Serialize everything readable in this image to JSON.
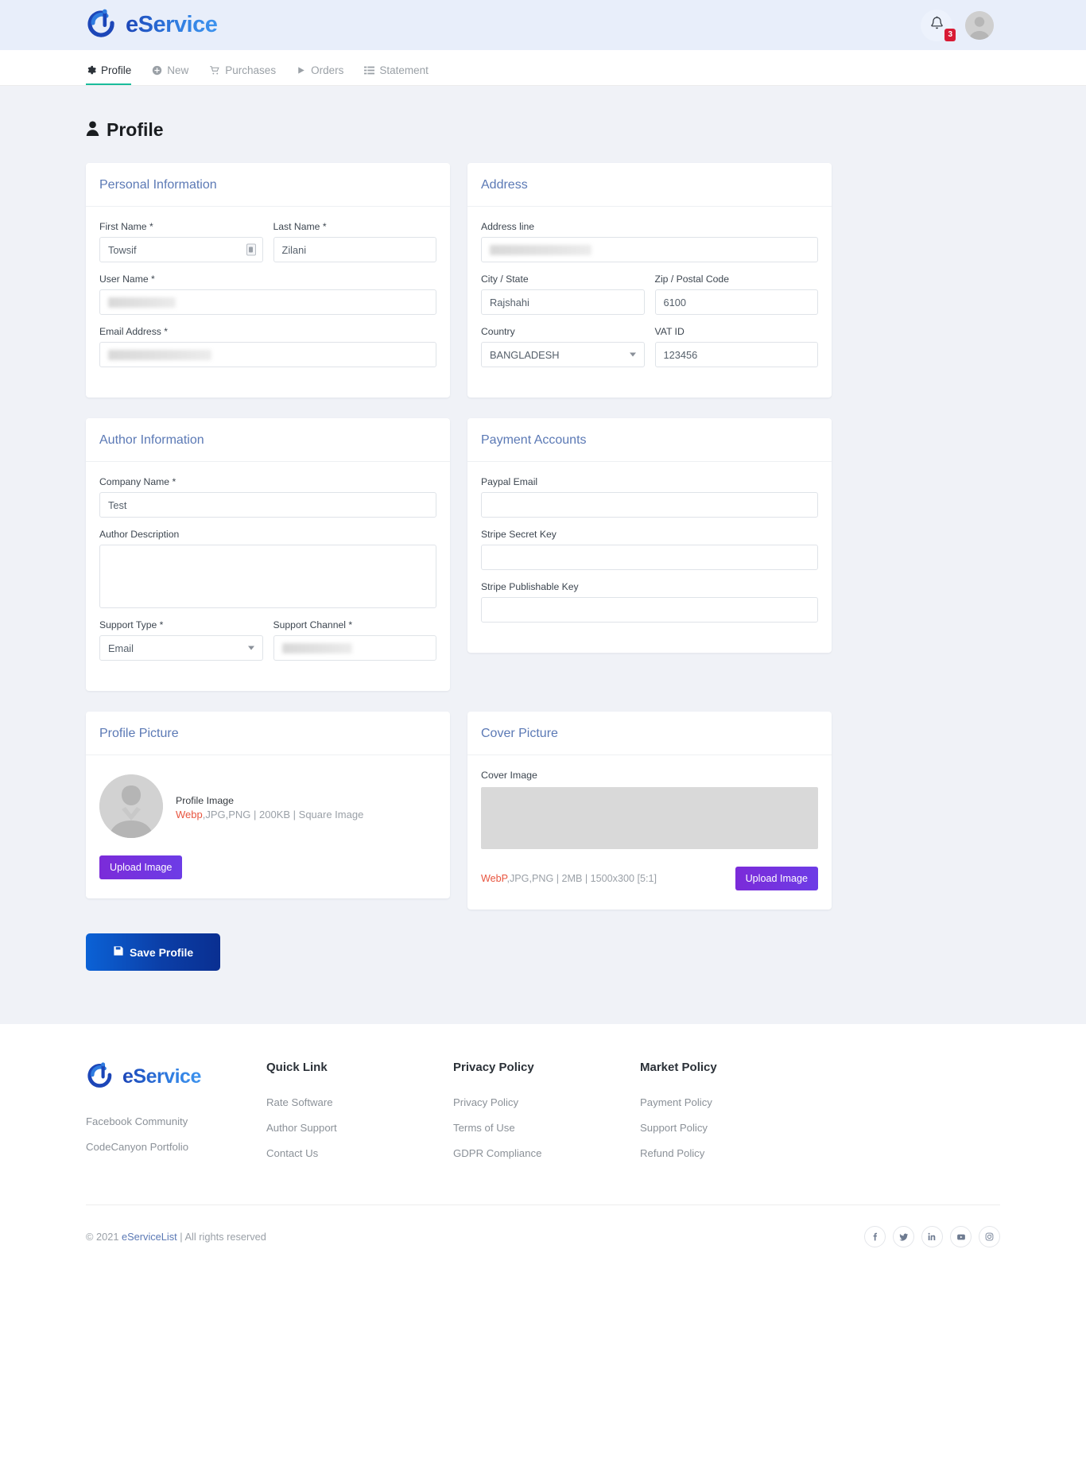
{
  "brand": {
    "name": "eService",
    "logo_icon": "eservice-logo-icon"
  },
  "topbar": {
    "bell_icon": "bell-icon",
    "notification_count": "3",
    "avatar_icon": "user-avatar-icon"
  },
  "nav": {
    "tabs": [
      {
        "label": "Profile",
        "icon": "gear-icon",
        "active": true
      },
      {
        "label": "New",
        "icon": "plus-circle-icon",
        "active": false
      },
      {
        "label": "Purchases",
        "icon": "cart-icon",
        "active": false
      },
      {
        "label": "Orders",
        "icon": "play-icon",
        "active": false
      },
      {
        "label": "Statement",
        "icon": "list-icon",
        "active": false
      }
    ]
  },
  "page": {
    "title": "Profile",
    "title_icon": "user-icon"
  },
  "personal_information": {
    "heading": "Personal Information",
    "first_name_label": "First Name *",
    "first_name_value": "Towsif",
    "last_name_label": "Last Name *",
    "last_name_value": "Zilani",
    "user_name_label": "User Name *",
    "user_name_value": "",
    "email_label": "Email Address *",
    "email_value": ""
  },
  "address": {
    "heading": "Address",
    "address_line_label": "Address line",
    "address_line_value": "",
    "city_label": "City / State",
    "city_value": "Rajshahi",
    "zip_label": "Zip / Postal Code",
    "zip_value": "6100",
    "country_label": "Country",
    "country_value": "BANGLADESH",
    "vat_label": "VAT ID",
    "vat_value": "123456"
  },
  "author_information": {
    "heading": "Author Information",
    "company_label": "Company Name *",
    "company_value": "Test",
    "description_label": "Author Description",
    "description_value": "",
    "support_type_label": "Support Type *",
    "support_type_value": "Email",
    "support_channel_label": "Support Channel *",
    "support_channel_value": ""
  },
  "payment_accounts": {
    "heading": "Payment Accounts",
    "paypal_label": "Paypal Email",
    "paypal_value": "",
    "stripe_secret_label": "Stripe Secret Key",
    "stripe_secret_value": "",
    "stripe_publishable_label": "Stripe Publishable Key",
    "stripe_publishable_value": ""
  },
  "profile_picture": {
    "heading": "Profile Picture",
    "image_title": "Profile Image",
    "spec_highlight": "Webp",
    "spec_rest": ",JPG,PNG | 200KB | Square Image",
    "upload_label": "Upload Image",
    "avatar_icon": "user-avatar-icon"
  },
  "cover_picture": {
    "heading": "Cover Picture",
    "image_label": "Cover Image",
    "spec_highlight": "WebP",
    "spec_rest": ",JPG,PNG | 2MB | 1500x300 [5:1]",
    "upload_label": "Upload Image"
  },
  "save": {
    "label": "Save Profile",
    "icon": "save-icon"
  },
  "footer": {
    "brand_name": "eService",
    "brand_links": [
      {
        "label": "Facebook Community"
      },
      {
        "label": "CodeCanyon Portfolio"
      }
    ],
    "columns": [
      {
        "heading": "Quick Link",
        "links": [
          {
            "label": "Rate Software"
          },
          {
            "label": "Author Support"
          },
          {
            "label": "Contact Us"
          }
        ]
      },
      {
        "heading": "Privacy Policy",
        "links": [
          {
            "label": "Privacy Policy"
          },
          {
            "label": "Terms of Use"
          },
          {
            "label": "GDPR Compliance"
          }
        ]
      },
      {
        "heading": "Market Policy",
        "links": [
          {
            "label": "Payment Policy"
          },
          {
            "label": "Support Policy"
          },
          {
            "label": "Refund Policy"
          }
        ]
      }
    ],
    "copyright_prefix": "© 2021 ",
    "copyright_link": "eServiceList",
    "copyright_suffix": " | All rights reserved",
    "socials": [
      {
        "icon": "facebook-icon",
        "glyph": "f"
      },
      {
        "icon": "twitter-icon",
        "glyph": "t"
      },
      {
        "icon": "linkedin-icon",
        "glyph": "in"
      },
      {
        "icon": "youtube-icon",
        "glyph": "y"
      },
      {
        "icon": "instagram-icon",
        "glyph": "o"
      }
    ]
  },
  "colors": {
    "accent_blue": "#2f7ce0",
    "heading_blue": "#5b79b5",
    "active_tab_underline": "#1abc9c",
    "badge_red": "#d81b34",
    "spec_red": "#e8553f",
    "upload_purple": "#7a29d8",
    "page_bg": "#f0f2f7",
    "topbar_bg": "#e8eefa"
  }
}
